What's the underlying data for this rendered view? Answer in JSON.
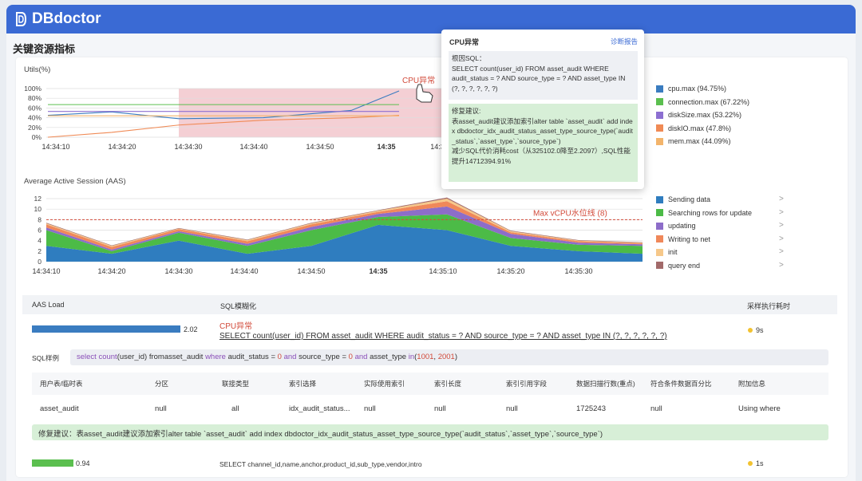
{
  "app": {
    "name": "DBdoctor"
  },
  "page": {
    "title": "关键资源指标"
  },
  "colors": {
    "cpu": "#3a7cc0",
    "connection": "#5bbf4f",
    "disk": "#8c6fd1",
    "diskio": "#f08a55",
    "mem": "#f3b46b",
    "aas_send": "#2f7dbf",
    "aas_search": "#4cbb47",
    "aas_update": "#8d6dc9",
    "aas_write": "#f0885a",
    "aas_init": "#f6c88a",
    "aas_query": "#a26a6a"
  },
  "chart_data": [
    {
      "type": "line",
      "title": "Utils(%)",
      "x": [
        "14:34:10",
        "14:34:20",
        "14:34:30",
        "14:34:40",
        "14:34:50",
        "14:35",
        "14:3"
      ],
      "ylim": [
        0,
        100
      ],
      "yticks": [
        "100%",
        "80%",
        "60%",
        "40%",
        "20%",
        "0%"
      ],
      "annotation": "CPU异常",
      "series": [
        {
          "name": "cpu.max (94.75%)",
          "values": [
            45,
            52,
            38,
            40,
            55,
            95
          ]
        },
        {
          "name": "connection.max (67.22%)",
          "values": [
            67,
            67,
            67,
            67,
            67,
            67
          ]
        },
        {
          "name": "diskSize.max (53.22%)",
          "values": [
            53,
            53,
            53,
            53,
            53,
            53
          ]
        },
        {
          "name": "diskIO.max (47.8%)",
          "values": [
            0,
            10,
            25,
            35,
            40,
            45
          ]
        },
        {
          "name": "mem.max (44.09%)",
          "values": [
            44,
            44,
            44,
            44,
            44,
            44
          ]
        }
      ]
    },
    {
      "type": "area",
      "title": "Average Active Session (AAS)",
      "x": [
        "14:34:10",
        "14:34:20",
        "14:34:30",
        "14:34:40",
        "14:34:50",
        "14:35",
        "14:35:10",
        "14:35:20",
        "14:35:30"
      ],
      "ylim": [
        0,
        12
      ],
      "yticks": [
        "12",
        "10",
        "8",
        "6",
        "4",
        "2",
        "0"
      ],
      "threshold_label": "Max vCPU水位线 (8)",
      "threshold": 8,
      "series": [
        {
          "name": "Sending data",
          "values": [
            3,
            1.5,
            4,
            1.5,
            3,
            7,
            6,
            3,
            2,
            1.5
          ]
        },
        {
          "name": "Searching rows for update",
          "values": [
            3,
            0.5,
            1.5,
            1.5,
            3,
            1.5,
            3,
            1.5,
            1.2,
            1.5
          ]
        },
        {
          "name": "updating",
          "values": [
            0.5,
            0.3,
            0.3,
            0.4,
            0.6,
            0.6,
            1.5,
            0.8,
            0.4,
            0.3
          ]
        },
        {
          "name": "Writing to net",
          "values": [
            0.6,
            0.5,
            0.4,
            0.5,
            0.5,
            0.4,
            1.0,
            0.3,
            0.3,
            0.2
          ]
        },
        {
          "name": "init",
          "values": [
            0.2,
            0.2,
            0.1,
            0.2,
            0.2,
            0.2,
            0.5,
            0.2,
            0.1,
            0.1
          ]
        },
        {
          "name": "query end",
          "values": [
            0.1,
            0.1,
            0.1,
            0.1,
            0.1,
            0.1,
            0.2,
            0.1,
            0.1,
            0.1
          ]
        }
      ]
    }
  ],
  "tooltip": {
    "title": "CPU异常",
    "link": "诊断报告",
    "root_label": "根因SQL：",
    "root_sql": "SELECT count(user_id) FROM asset_audit WHERE audit_status = ? AND source_type = ? AND asset_type IN (?, ?, ?, ?, ?, ?)",
    "fix_label": "修复建议:",
    "fix_text": "表asset_audit建议添加索引alter table `asset_audit` add index dbdoctor_idx_audit_status_asset_type_source_type(`audit_status`,`asset_type`,`source_type`)",
    "fix_result": "减少SQL代价消耗cost（从325102.0降至2.2097）,SQL性能提升14712394.91%"
  },
  "table": {
    "headers": {
      "aas_load": "AAS Load",
      "sql_template": "SQL模糊化",
      "exec_time": "采样执行耗时"
    },
    "rows": [
      {
        "load_value": "2.02",
        "load_fraction": 0.75,
        "tag": "CPU异常",
        "sql": "SELECT  count(user_id) FROM asset_audit WHERE audit_status = ? AND source_type = ? AND asset_type IN (?, ?, ?, ?, ?, ?)",
        "time": "9s"
      },
      {
        "load_value": "0.94",
        "load_fraction": 0.35,
        "sql": "SELECT channel_id,name,anchor,product_id,sub_type,vendor,intro",
        "time": "1s"
      }
    ],
    "sample": {
      "label": "SQL样例",
      "p1": "select count",
      "p2": "(user_id) fromasset_audit ",
      "p3": "where",
      "p4": " audit_status = ",
      "p5": "0",
      "p6": " and",
      "p7": " source_type = ",
      "p8": "0",
      "p9": " and",
      "p10": " asset_type ",
      "p11": "in",
      "p12": "(",
      "p13": "1001",
      "p14": ", ",
      "p15": "2001",
      "p16": ")"
    },
    "explain_headers": [
      "用户表/临时表",
      "分区",
      "联接类型",
      "索引选择",
      "实际使用索引",
      "索引长度",
      "索引引用字段",
      "数据扫描行数(重点)",
      "符合条件数据百分比",
      "附加信息"
    ],
    "explain_row": [
      "asset_audit",
      "null",
      "all",
      "idx_audit_status...",
      "null",
      "null",
      "null",
      "1725243",
      "null",
      "Using where"
    ],
    "fix": "修复建议：表asset_audit建议添加索引alter table `asset_audit` add index dbdoctor_idx_audit_status_asset_type_source_type(`audit_status`,`asset_type`,`source_type`)"
  }
}
